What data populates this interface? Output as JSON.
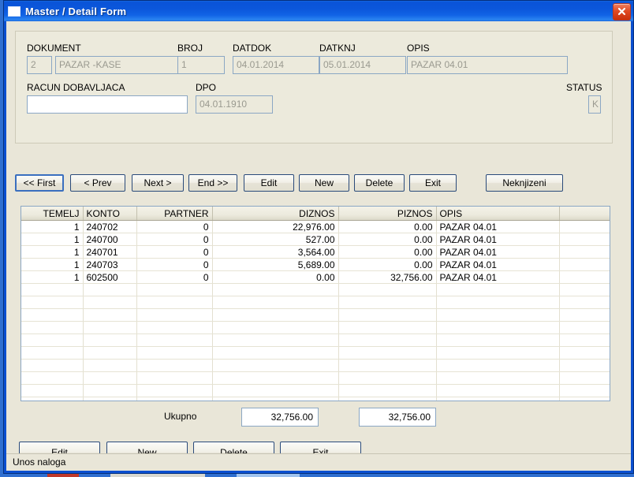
{
  "window": {
    "title": "Master / Detail Form",
    "icon": "window-icon",
    "close_label": "close-icon",
    "accent_color": "#0a53d8",
    "close_color": "#c8300d"
  },
  "header_form": {
    "fields": [
      {
        "label": "DOKUMENT",
        "value": "2",
        "readonly": true
      },
      {
        "label": "",
        "value": "PAZAR -KASE",
        "readonly": true
      },
      {
        "label": "BROJ",
        "value": "1",
        "readonly": true
      },
      {
        "label": "DATDOK",
        "value": "04.01.2014",
        "readonly": true
      },
      {
        "label": "DATKNJ",
        "value": "05.01.2014",
        "readonly": true
      },
      {
        "label": "OPIS",
        "value": "PAZAR 04.01",
        "readonly": true
      },
      {
        "label": "RACUN DOBAVLJACA",
        "value": "",
        "readonly": false
      },
      {
        "label": "DPO",
        "value": "04.01.1910",
        "readonly": true
      },
      {
        "label": "STATUS",
        "value": "K",
        "readonly": true
      }
    ]
  },
  "nav_buttons": [
    {
      "label": "<< First",
      "focused": true
    },
    {
      "label": "< Prev",
      "focused": false
    },
    {
      "label": "Next >",
      "focused": false
    },
    {
      "label": "End >>",
      "focused": false
    },
    {
      "label": "Edit",
      "focused": false
    },
    {
      "label": "New",
      "focused": false
    },
    {
      "label": "Delete",
      "focused": false
    },
    {
      "label": "Exit",
      "focused": false
    },
    {
      "label": "Neknjizeni",
      "focused": false
    }
  ],
  "grid": {
    "columns": [
      {
        "header": "TEMELJ",
        "align": "right"
      },
      {
        "header": "KONTO",
        "align": "left"
      },
      {
        "header": "PARTNER",
        "align": "right"
      },
      {
        "header": "DIZNOS",
        "align": "right"
      },
      {
        "header": "PIZNOS",
        "align": "right"
      },
      {
        "header": "OPIS",
        "align": "left"
      },
      {
        "header": "",
        "align": "left"
      }
    ],
    "rows": [
      [
        "1",
        "240702",
        "0",
        "22,976.00",
        "0.00",
        "PAZAR 04.01",
        ""
      ],
      [
        "1",
        "240700",
        "0",
        "527.00",
        "0.00",
        "PAZAR 04.01",
        ""
      ],
      [
        "1",
        "240701",
        "0",
        "3,564.00",
        "0.00",
        "PAZAR 04.01",
        ""
      ],
      [
        "1",
        "240703",
        "0",
        "5,689.00",
        "0.00",
        "PAZAR 04.01",
        ""
      ],
      [
        "1",
        "602500",
        "0",
        "0.00",
        "32,756.00",
        "PAZAR 04.01",
        ""
      ]
    ],
    "empty_row_count": 10
  },
  "totals": {
    "label": "Ukupno",
    "debit_total": "32,756.00",
    "credit_total": "32,756.00"
  },
  "bottom_buttons": [
    {
      "label": "Edit"
    },
    {
      "label": "New"
    },
    {
      "label": "Delete"
    },
    {
      "label": "Exit"
    }
  ],
  "statusbar": {
    "text": "Unos naloga"
  }
}
